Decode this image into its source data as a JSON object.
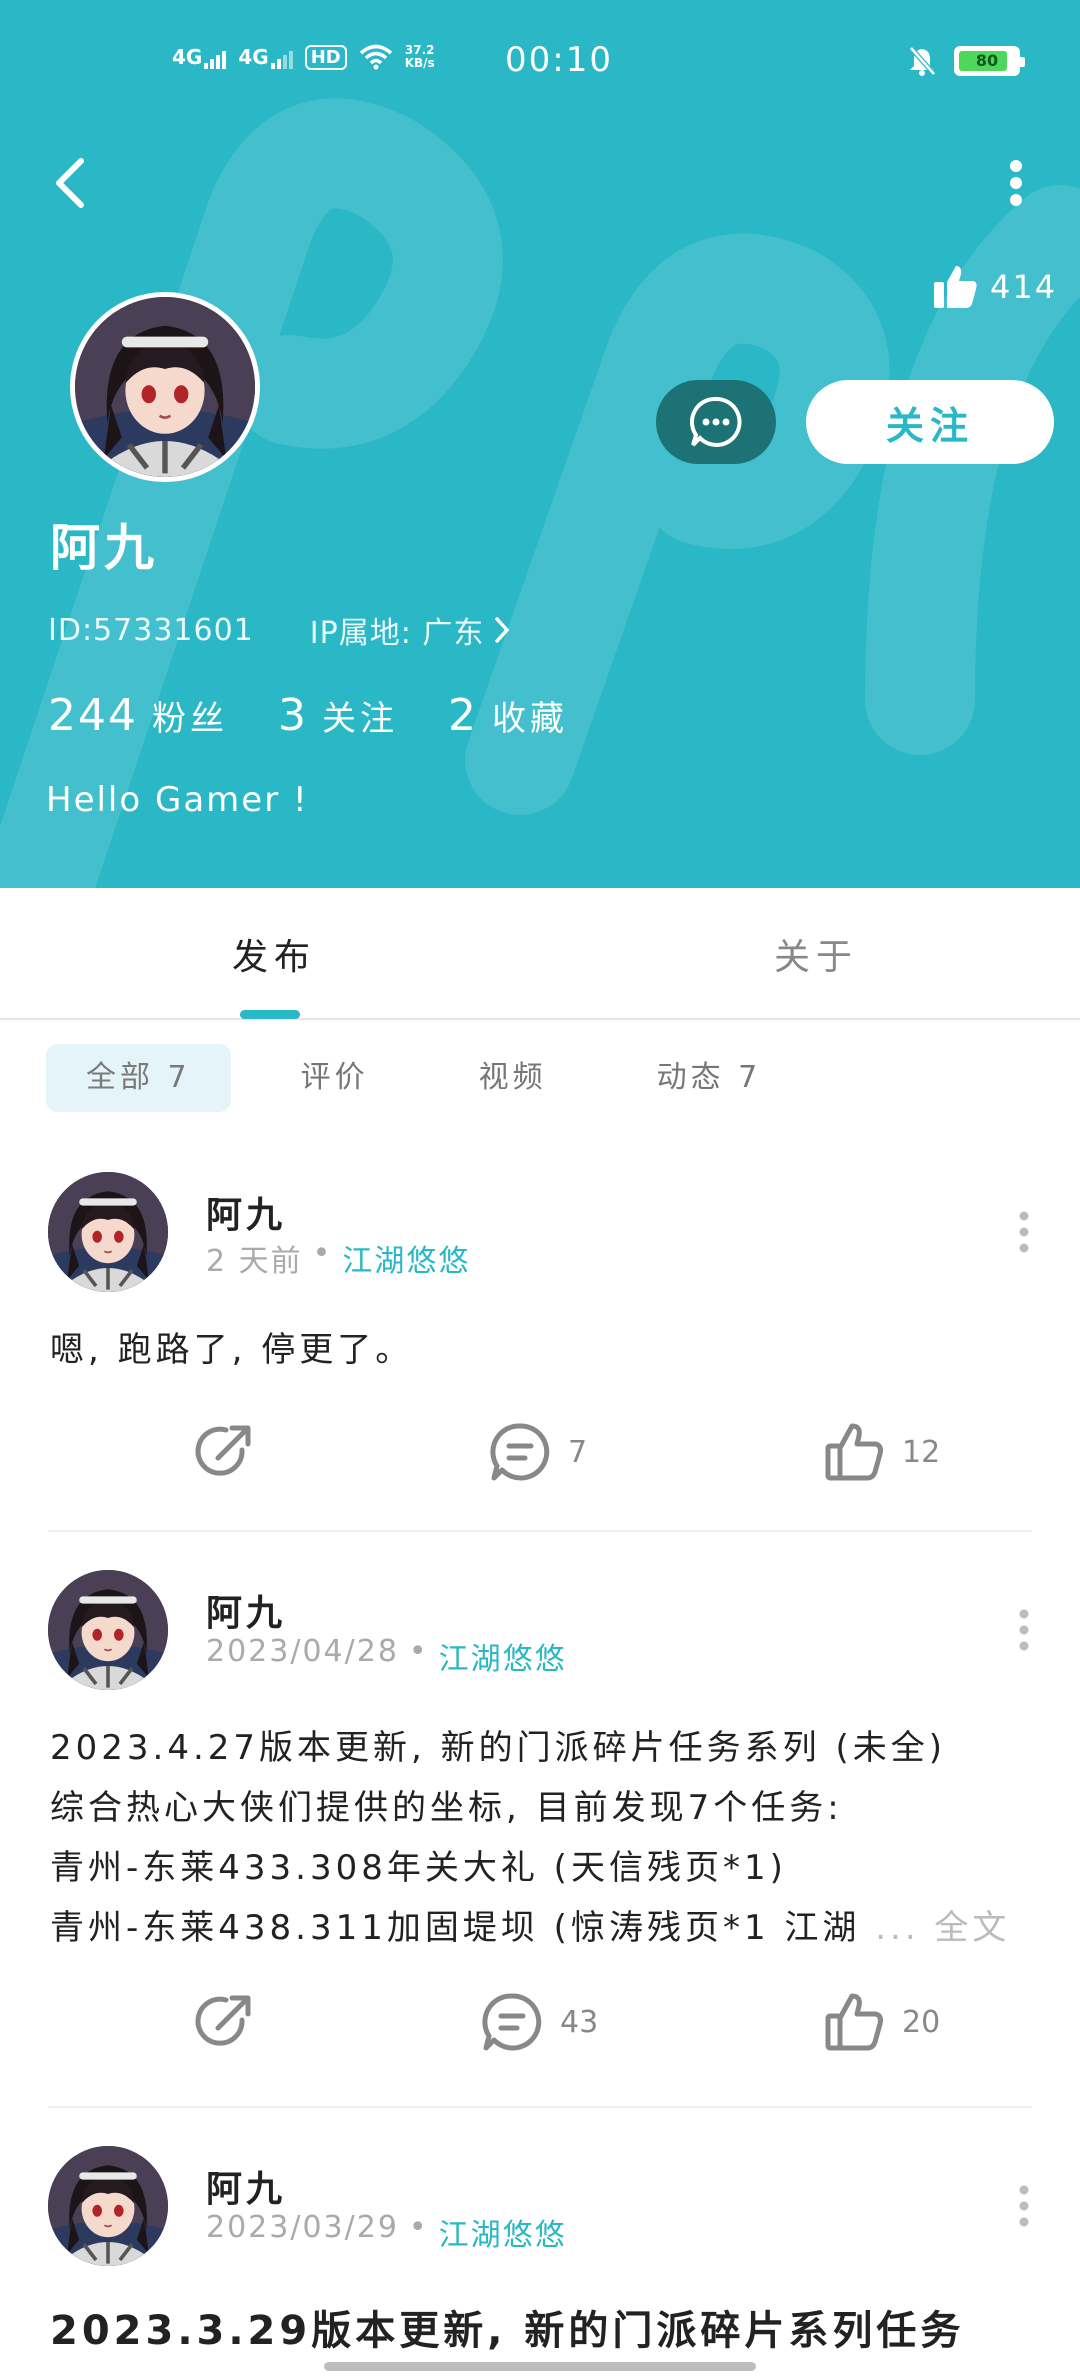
{
  "status_bar": {
    "signal_1": "4G",
    "signal_2": "4G",
    "hd": "HD",
    "speed_value": "37.2",
    "speed_unit": "KB/s",
    "time": "00:10",
    "battery": "80"
  },
  "profile": {
    "likes": "414",
    "name": "阿九",
    "id_text": "ID:57331601",
    "ip_text": "IP属地: 广东",
    "follow_label": "关注",
    "stats": [
      {
        "num": "244",
        "label": "粉丝"
      },
      {
        "num": "3",
        "label": "关注"
      },
      {
        "num": "2",
        "label": "收藏"
      }
    ],
    "bio": "Hello Gamer !"
  },
  "tabs": [
    "发布",
    "关于"
  ],
  "filters": [
    "全部 7",
    "评价",
    "视频",
    "动态 7"
  ],
  "posts": [
    {
      "author": "阿九",
      "time": "2 天前",
      "sep": "•",
      "group": "江湖悠悠",
      "body": [
        "嗯, 跑路了, 停更了。"
      ],
      "comments": "7",
      "likes": "12"
    },
    {
      "author": "阿九",
      "time": "2023/04/28",
      "sep": "•",
      "group": "江湖悠悠",
      "body": [
        "2023.4.27版本更新, 新的门派碎片任务系列 (未全)",
        "综合热心大侠们提供的坐标, 目前发现7个任务:",
        "青州-东莱433.308年关大礼 (天信残页*1)",
        "青州-东莱438.311加固堤坝 (惊涛残页*1 江湖"
      ],
      "more": "... 全文",
      "comments": "43",
      "likes": "20"
    },
    {
      "author": "阿九",
      "time": "2023/03/29",
      "sep": "•",
      "group": "江湖悠悠",
      "title": "2023.3.29版本更新, 新的门派碎片系列任务"
    }
  ],
  "colors": {
    "brand": "#2ab7c6",
    "message_button": "#1d7276"
  },
  "icons": [
    "back-icon",
    "more-vertical-icon",
    "thumbs-up-icon",
    "message-icon",
    "share-icon",
    "comment-icon",
    "like-icon"
  ]
}
